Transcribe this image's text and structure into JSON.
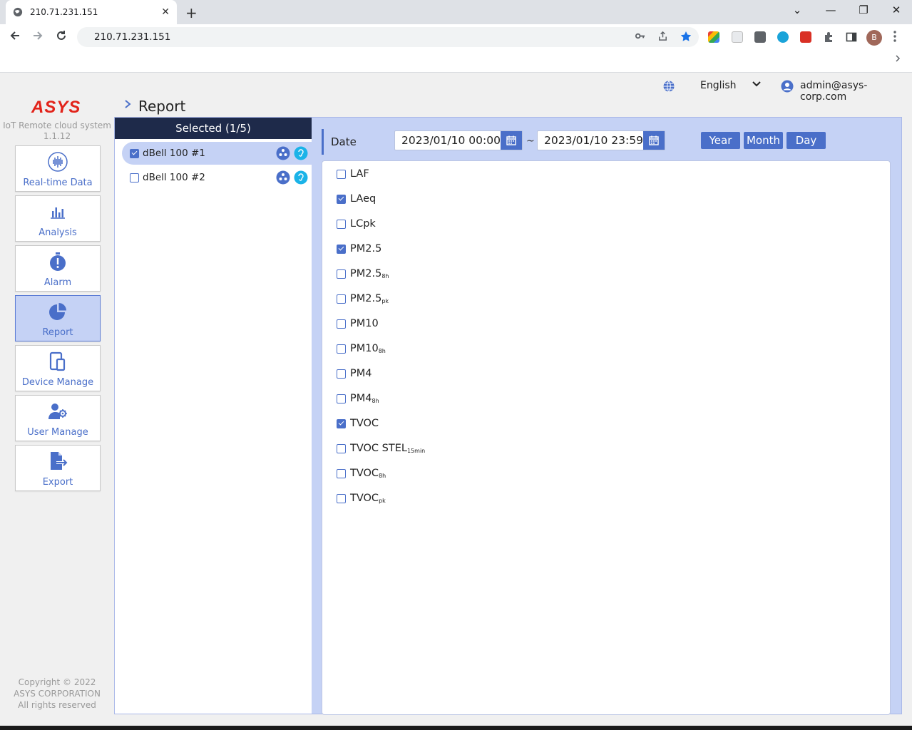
{
  "browser": {
    "tab_title": "210.71.231.151",
    "tab_close": "✕",
    "new_tab": "+",
    "url": "210.71.231.151",
    "avatar_letter": "B",
    "window_controls": {
      "minimize": "⌄",
      "restore": "—",
      "maximize": "❐",
      "close": "✕"
    }
  },
  "header": {
    "language": "English",
    "user_email": "admin@asys-corp.com"
  },
  "brand": {
    "logo": "ASYS",
    "system_name": "IoT Remote cloud system",
    "version": "1.1.12",
    "copyright": "Copyright © 2022 ASYS CORPORATION All rights reserved"
  },
  "sidebar": {
    "items": [
      {
        "label": "Real-time Data",
        "icon": "waveform-icon"
      },
      {
        "label": "Analysis",
        "icon": "bar-chart-icon"
      },
      {
        "label": "Alarm",
        "icon": "stopwatch-alert-icon"
      },
      {
        "label": "Report",
        "icon": "pie-chart-icon",
        "active": true
      },
      {
        "label": "Device Manage",
        "icon": "tablet-phone-icon"
      },
      {
        "label": "User Manage",
        "icon": "user-gear-icon"
      },
      {
        "label": "Export",
        "icon": "file-export-icon"
      }
    ]
  },
  "page": {
    "breadcrumb": "Report"
  },
  "devices": {
    "header": "Selected (1/5)",
    "items": [
      {
        "name": "dBell 100 #1",
        "checked": true
      },
      {
        "name": "dBell 100 #2",
        "checked": false
      }
    ]
  },
  "date": {
    "label": "Date",
    "start": "2023/01/10 00:00",
    "end": "2023/01/10 23:59",
    "separator": "~",
    "periods": [
      "Year",
      "Month",
      "Day"
    ]
  },
  "parameters": [
    {
      "base": "LAF",
      "sub": "",
      "checked": false
    },
    {
      "base": "LAeq",
      "sub": "",
      "checked": true
    },
    {
      "base": "LCpk",
      "sub": "",
      "checked": false
    },
    {
      "base": "PM2.5",
      "sub": "",
      "checked": true
    },
    {
      "base": "PM2.5",
      "sub": "8h",
      "checked": false
    },
    {
      "base": "PM2.5",
      "sub": "pk",
      "checked": false
    },
    {
      "base": "PM10",
      "sub": "",
      "checked": false
    },
    {
      "base": "PM10",
      "sub": "8h",
      "checked": false
    },
    {
      "base": "PM4",
      "sub": "",
      "checked": false
    },
    {
      "base": "PM4",
      "sub": "8h",
      "checked": false
    },
    {
      "base": "TVOC",
      "sub": "",
      "checked": true
    },
    {
      "base": "TVOC STEL",
      "sub": "15min",
      "checked": false
    },
    {
      "base": "TVOC",
      "sub": "8h",
      "checked": false
    },
    {
      "base": "TVOC",
      "sub": "pk",
      "checked": false
    }
  ]
}
